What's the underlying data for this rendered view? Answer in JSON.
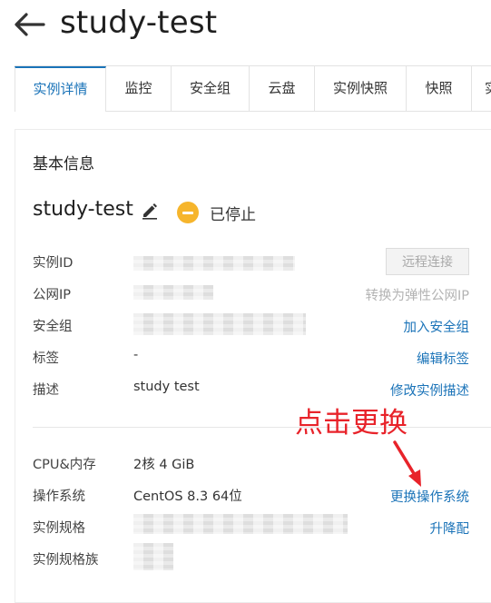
{
  "header": {
    "title": "study-test"
  },
  "tabs": [
    {
      "label": "实例详情",
      "active": true
    },
    {
      "label": "监控"
    },
    {
      "label": "安全组"
    },
    {
      "label": "云盘"
    },
    {
      "label": "实例快照"
    },
    {
      "label": "快照"
    },
    {
      "label": "实"
    }
  ],
  "section": {
    "title": "基本信息"
  },
  "instance": {
    "name": "study-test",
    "status": "已停止",
    "status_color": "#f6b52c"
  },
  "rows": {
    "instance_id": {
      "label": "实例ID",
      "action": "远程连接"
    },
    "public_ip": {
      "label": "公网IP",
      "action": "转换为弹性公网IP"
    },
    "security_group": {
      "label": "安全组",
      "action": "加入安全组"
    },
    "tags": {
      "label": "标签",
      "value": "-",
      "action": "编辑标签"
    },
    "description": {
      "label": "描述",
      "value": "study test",
      "action": "修改实例描述"
    },
    "cpu_mem": {
      "label": "CPU&内存",
      "value": "2核 4 GiB"
    },
    "os": {
      "label": "操作系统",
      "value": "CentOS 8.3 64位",
      "action": "更换操作系统"
    },
    "spec": {
      "label": "实例规格",
      "action": "升降配"
    },
    "spec_family": {
      "label": "实例规格族"
    }
  },
  "annotation": {
    "text": "点击更换",
    "color": "#e8232a"
  },
  "colors": {
    "link": "#1a73b8",
    "accent": "#1a73b8"
  }
}
